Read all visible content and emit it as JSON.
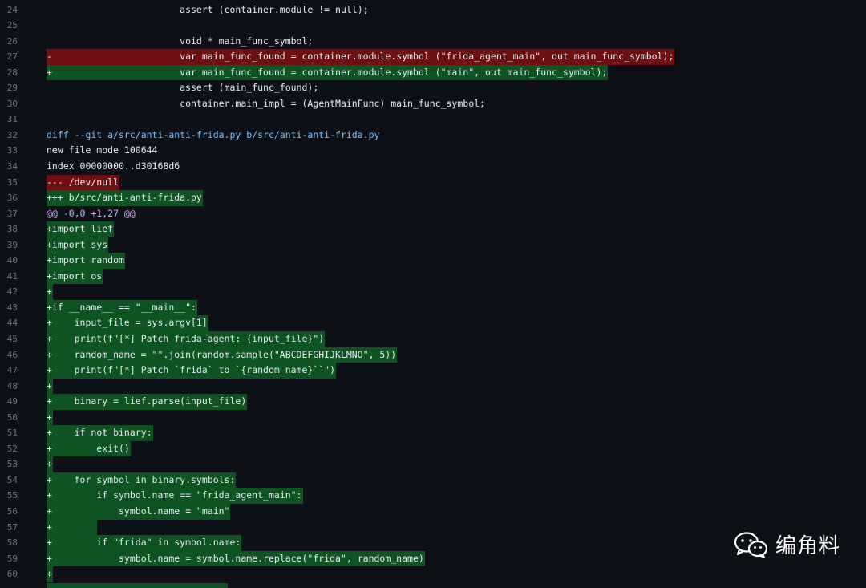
{
  "diff": {
    "lines": [
      {
        "n": "24",
        "t": "ctx",
        "prefix": "",
        "text": "                        assert (container.module != null);"
      },
      {
        "n": "25",
        "t": "ctx",
        "prefix": "",
        "text": ""
      },
      {
        "n": "26",
        "t": "ctx",
        "prefix": "",
        "text": "                        void * main_func_symbol;"
      },
      {
        "n": "27",
        "t": "del",
        "prefix": "-",
        "text": "                       var main_func_found = container.module.symbol (\"frida_agent_main\", out main_func_symbol);"
      },
      {
        "n": "28",
        "t": "add",
        "prefix": "+",
        "text": "                       var main_func_found = container.module.symbol (\"main\", out main_func_symbol);"
      },
      {
        "n": "29",
        "t": "ctx",
        "prefix": "",
        "text": "                        assert (main_func_found);"
      },
      {
        "n": "30",
        "t": "ctx",
        "prefix": "",
        "text": "                        container.main_impl = (AgentMainFunc) main_func_symbol;"
      },
      {
        "n": "31",
        "t": "ctx",
        "prefix": "",
        "text": ""
      },
      {
        "n": "32",
        "t": "header",
        "prefix": "",
        "text": "diff --git a/src/anti-anti-frida.py b/src/anti-anti-frida.py"
      },
      {
        "n": "33",
        "t": "meta",
        "prefix": "",
        "text": "new file mode 100644"
      },
      {
        "n": "34",
        "t": "meta",
        "prefix": "",
        "text": "index 00000000..d30168d6"
      },
      {
        "n": "35",
        "t": "del",
        "prefix": "",
        "text": "--- /dev/null"
      },
      {
        "n": "36",
        "t": "add",
        "prefix": "",
        "text": "+++ b/src/anti-anti-frida.py"
      },
      {
        "n": "37",
        "t": "hunk",
        "prefix": "",
        "text": "@@ -0,0 +1,27 @@"
      },
      {
        "n": "38",
        "t": "add",
        "prefix": "",
        "text": "+import lief"
      },
      {
        "n": "39",
        "t": "add",
        "prefix": "",
        "text": "+import sys"
      },
      {
        "n": "40",
        "t": "add",
        "prefix": "",
        "text": "+import random"
      },
      {
        "n": "41",
        "t": "add",
        "prefix": "",
        "text": "+import os"
      },
      {
        "n": "42",
        "t": "add",
        "prefix": "",
        "text": "+"
      },
      {
        "n": "43",
        "t": "add",
        "prefix": "",
        "text": "+if __name__ == \"__main__\":"
      },
      {
        "n": "44",
        "t": "add",
        "prefix": "",
        "text": "+    input_file = sys.argv[1]"
      },
      {
        "n": "45",
        "t": "add",
        "prefix": "",
        "text": "+    print(f\"[*] Patch frida-agent: {input_file}\")"
      },
      {
        "n": "46",
        "t": "add",
        "prefix": "",
        "text": "+    random_name = \"\".join(random.sample(\"ABCDEFGHIJKLMNO\", 5))"
      },
      {
        "n": "47",
        "t": "add",
        "prefix": "",
        "text": "+    print(f\"[*] Patch `frida` to `{random_name}``\")"
      },
      {
        "n": "48",
        "t": "add",
        "prefix": "",
        "text": "+"
      },
      {
        "n": "49",
        "t": "add",
        "prefix": "",
        "text": "+    binary = lief.parse(input_file)"
      },
      {
        "n": "50",
        "t": "add",
        "prefix": "",
        "text": "+"
      },
      {
        "n": "51",
        "t": "add",
        "prefix": "",
        "text": "+    if not binary:"
      },
      {
        "n": "52",
        "t": "add",
        "prefix": "",
        "text": "+        exit()"
      },
      {
        "n": "53",
        "t": "add",
        "prefix": "",
        "text": "+"
      },
      {
        "n": "54",
        "t": "add",
        "prefix": "",
        "text": "+    for symbol in binary.symbols:"
      },
      {
        "n": "55",
        "t": "add",
        "prefix": "",
        "text": "+        if symbol.name == \"frida_agent_main\":"
      },
      {
        "n": "56",
        "t": "add",
        "prefix": "",
        "text": "+            symbol.name = \"main\""
      },
      {
        "n": "57",
        "t": "add",
        "prefix": "",
        "text": "+        "
      },
      {
        "n": "58",
        "t": "add",
        "prefix": "",
        "text": "+        if \"frida\" in symbol.name:"
      },
      {
        "n": "59",
        "t": "add",
        "prefix": "",
        "text": "+            symbol.name = symbol.name.replace(\"frida\", random_name)"
      },
      {
        "n": "60",
        "t": "add",
        "prefix": "",
        "text": "+"
      }
    ]
  },
  "watermark": {
    "text": "编角料",
    "icon": "wechat-icon"
  },
  "colors": {
    "background": "#0d1117",
    "deletion": "#6e0f12",
    "addition": "#0f5323",
    "diff_header": "#79c0ff",
    "hunk_header": "#d2a8ff",
    "line_number": "#6e7681"
  }
}
